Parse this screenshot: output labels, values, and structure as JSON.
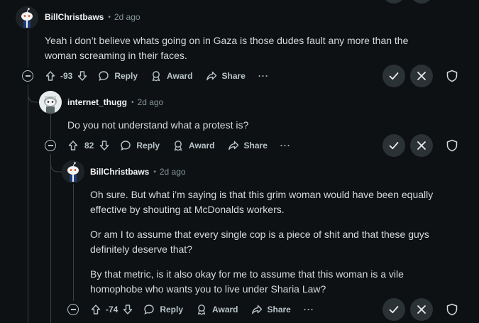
{
  "comments": [
    {
      "author": "BillChristbaws",
      "separator": "•",
      "time": "2d ago",
      "body": [
        "Yeah i don’t believe whats going on in Gaza is those dudes fault any more than the woman screaming in their faces."
      ],
      "score": "-93",
      "reply_label": "Reply",
      "award_label": "Award",
      "share_label": "Share",
      "more_label": "···"
    },
    {
      "author": "internet_thugg",
      "separator": "•",
      "time": "2d ago",
      "body": [
        "Do you not understand what a protest is?"
      ],
      "score": "82",
      "reply_label": "Reply",
      "award_label": "Award",
      "share_label": "Share",
      "more_label": "···"
    },
    {
      "author": "BillChristbaws",
      "separator": "•",
      "time": "2d ago",
      "body": [
        "Oh sure. But what i’m saying is that this grim woman would have been equally effective by shouting at McDonalds workers.",
        "Or am I to assume that every single cop is a piece of shit and that these guys definitely deserve that?",
        "By that metric, is it also okay for me to assume that this woman is a vile homophobe who wants you to live under Sharia Law?"
      ],
      "score": "-74",
      "reply_label": "Reply",
      "award_label": "Award",
      "share_label": "Share",
      "more_label": "···"
    }
  ],
  "colors": {
    "background": "#0e1113",
    "mod_button_bg": "#2a3236",
    "thread_line": "#3e4142",
    "meta_text": "#82959b"
  },
  "icons": {
    "upvote": "upvote-arrow-icon",
    "downvote": "downvote-arrow-icon",
    "reply": "speech-bubble-icon",
    "award": "award-icon",
    "share": "share-arrow-icon",
    "approve": "checkmark-icon",
    "remove": "x-icon",
    "mod": "shield-icon",
    "collapse": "collapse-minus-icon"
  }
}
